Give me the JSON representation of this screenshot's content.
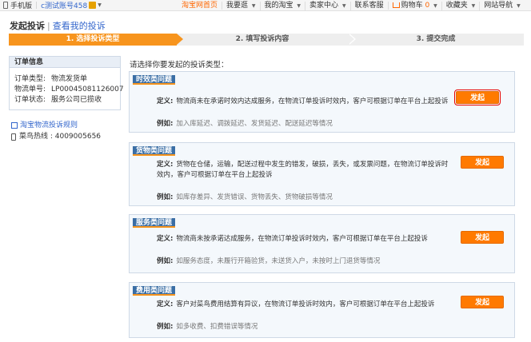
{
  "topbar": {
    "mobile_label": "手机版",
    "account_label": "c测试账号458",
    "nav": [
      "淘宝网首页",
      "我要逛",
      "我的淘宝",
      "卖家中心",
      "联系客服",
      "购物车",
      "收藏夹",
      "网站导航"
    ],
    "cart_count": "0",
    "accent_color": "#ff6600"
  },
  "title": {
    "main": "发起投诉",
    "sep": "|",
    "link": "查看我的投诉"
  },
  "steps": [
    "1. 选择投诉类型",
    "2. 填写投诉内容",
    "3. 提交完成"
  ],
  "order_info": {
    "header": "订单信息",
    "rows": [
      {
        "key": "订单类型:",
        "value": "物流发货单"
      },
      {
        "key": "物流单号:",
        "value": "LP00045081126007"
      },
      {
        "key": "订单状态:",
        "value": "服务公司已揽收"
      }
    ]
  },
  "links": {
    "rule": "淘宝物流投诉规则",
    "hotline": "菜鸟热线 : 4009005656"
  },
  "prompt": "请选择你要发起的投诉类型：",
  "categories": [
    {
      "tag": "时效类问题",
      "def_label": "定义:",
      "definition": "物流商未在承诺时效内达成服务，在物流订单投诉时效内，客户可根据订单在平台上起投诉",
      "definition2": "",
      "ex_label": "例如:",
      "example": "加入库延迟、调拨延迟、发货延迟、配送延迟等情况",
      "button": "发起"
    },
    {
      "tag": "货物类问题",
      "def_label": "定义:",
      "definition": "货物在仓储，运输，配送过程中发生的错发，破损，丢失，或发票问题，在物流订单投诉时",
      "definition2": "效内，客户可根据订单在平台上起投诉",
      "ex_label": "例如:",
      "example": "如库存差异、发货错误、货物丢失、货物破损等情况",
      "button": "发起"
    },
    {
      "tag": "服务类问题",
      "def_label": "定义:",
      "definition": "物流商未按承诺达成服务，在物流订单投诉时效内，客户可根据订单在平台上起投诉",
      "definition2": "",
      "ex_label": "例如:",
      "example": "如服务态度，未履行开箱验货，未送货入户，未按时上门退货等情况",
      "button": "发起"
    },
    {
      "tag": "费用类问题",
      "def_label": "定义:",
      "definition": "客户对菜鸟费用结算有异议，在物流订单投诉时效内，客户可根据订单在平台上起投诉",
      "definition2": "",
      "ex_label": "例如:",
      "example": "如多收费、扣费错误等情况",
      "button": "发起"
    }
  ]
}
